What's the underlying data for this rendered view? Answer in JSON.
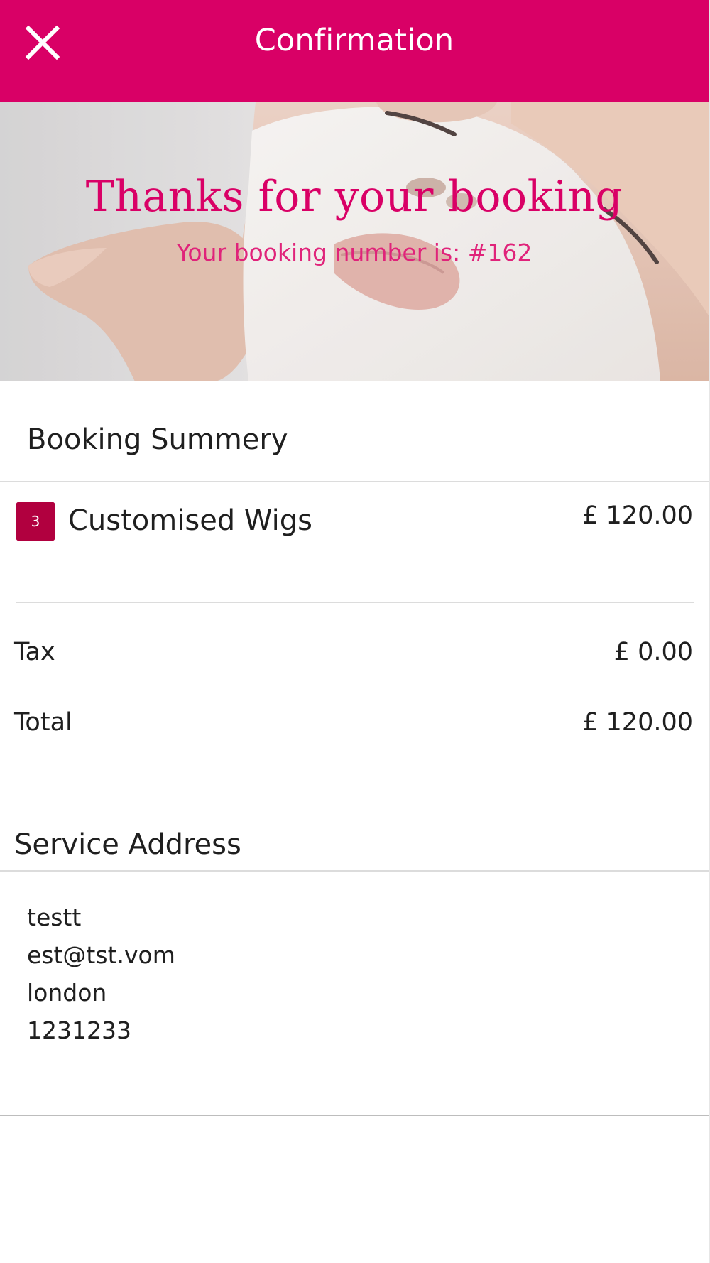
{
  "header": {
    "title": "Confirmation",
    "close_icon": "close-icon",
    "background": "#d90066"
  },
  "hero": {
    "title": "Thanks for your booking",
    "subtitle": "Your booking number is: #162",
    "image": "facial-mask-treatment-photo"
  },
  "summary": {
    "heading": "Booking Summery",
    "items": [
      {
        "quantity": "3",
        "name": "Customised Wigs",
        "price": "£ 120.00"
      }
    ],
    "tax_label": "Tax",
    "tax_value": "£ 0.00",
    "total_label": "Total",
    "total_value": "£ 120.00"
  },
  "address": {
    "heading": "Service Address",
    "lines": [
      "testt",
      "est@tst.vom",
      "london",
      "1231233"
    ]
  },
  "colors": {
    "brand": "#d90066",
    "badge": "#b1003f"
  }
}
